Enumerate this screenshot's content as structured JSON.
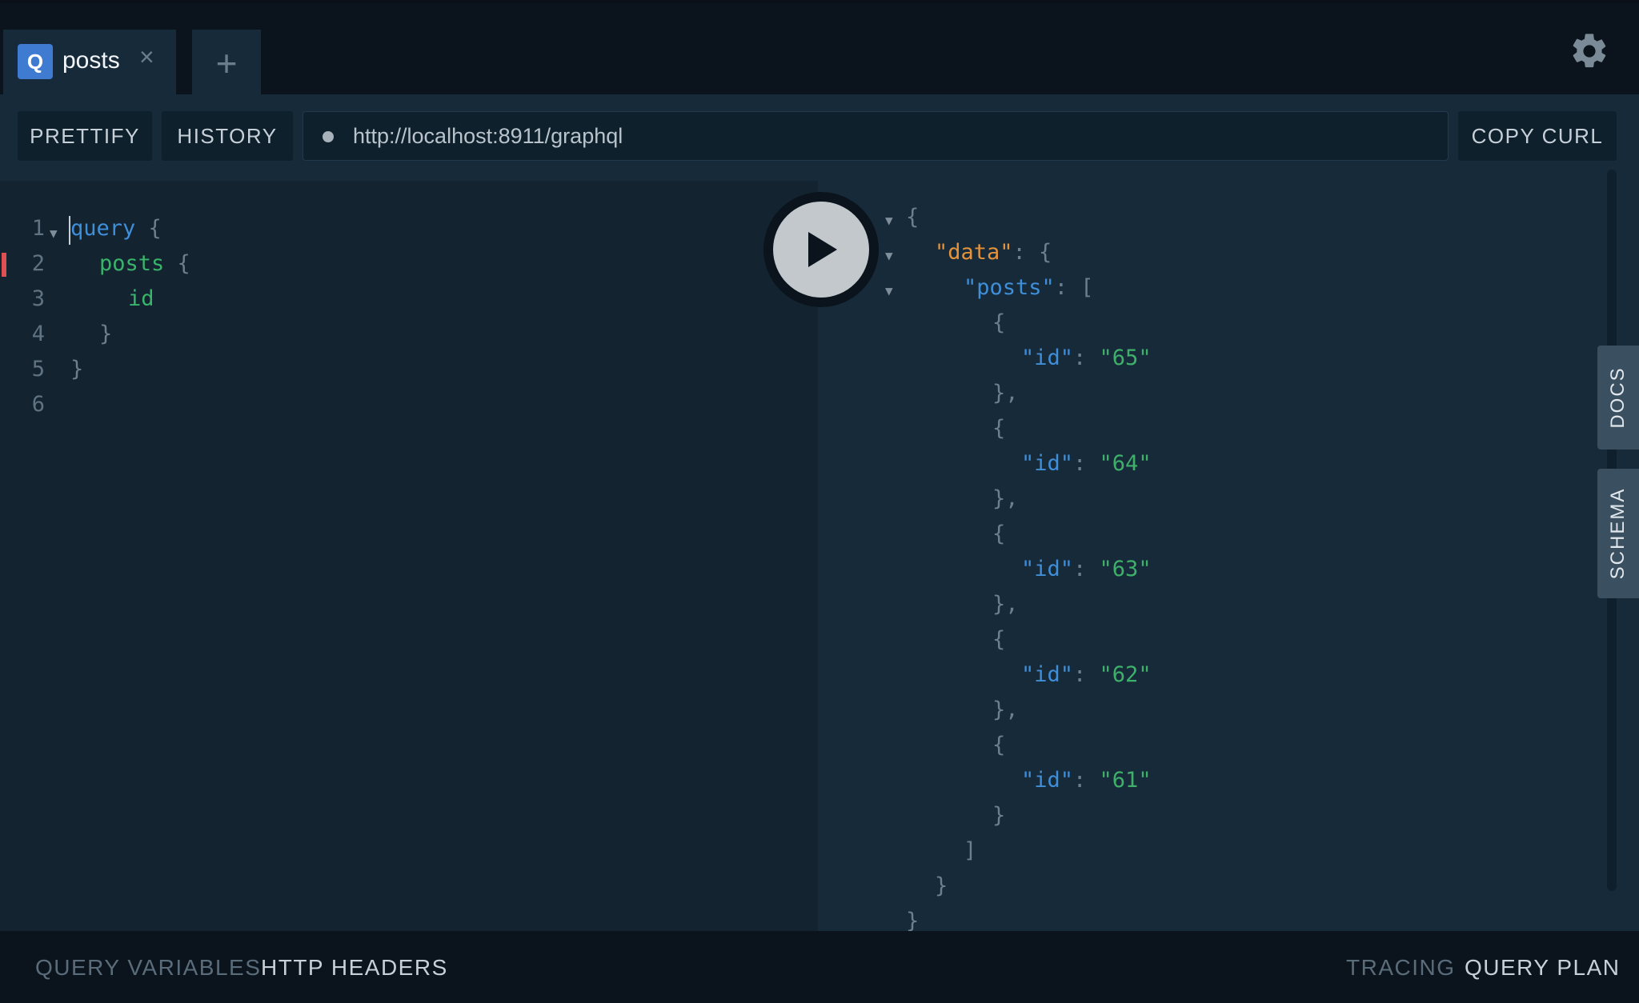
{
  "tabs": [
    {
      "badge": "Q",
      "title": "posts",
      "close": "×"
    }
  ],
  "tab_add": "+",
  "toolbar": {
    "prettify": "PRETTIFY",
    "history": "HISTORY",
    "url": "http://localhost:8911/graphql",
    "copy_curl": "COPY CURL"
  },
  "editor": {
    "line_numbers": [
      "1",
      "2",
      "3",
      "4",
      "5",
      "6"
    ],
    "lines": [
      [
        "query",
        " {"
      ],
      [
        "posts",
        " {"
      ],
      [
        "id"
      ],
      [
        "}"
      ],
      [
        "}"
      ]
    ]
  },
  "result": {
    "open_brace": "{",
    "data_key": "\"data\"",
    "colon_brace": ": {",
    "posts_key": "\"posts\"",
    "colon_bracket": ": [",
    "id_key": "\"id\"",
    "colon": ": ",
    "ids": [
      "\"65\"",
      "\"64\"",
      "\"63\"",
      "\"62\"",
      "\"61\""
    ],
    "obj_open": "{",
    "obj_close_comma": "},",
    "obj_close": "}",
    "arr_close": "]",
    "close_brace": "}"
  },
  "side_tabs": {
    "docs": "DOCS",
    "schema": "SCHEMA"
  },
  "bottom": {
    "query_variables": "QUERY VARIABLES",
    "http_headers": "HTTP HEADERS",
    "tracing": "TRACING",
    "query_plan": "QUERY PLAN"
  },
  "icons": {
    "settings": "gear-icon",
    "run": "play-icon",
    "fold": "triangle-down-icon"
  },
  "colors": {
    "accent": "#3f7bd1",
    "keyword": "#3f8fd8",
    "field": "#39b56b",
    "data_key": "#e3933a",
    "error": "#e05050"
  }
}
